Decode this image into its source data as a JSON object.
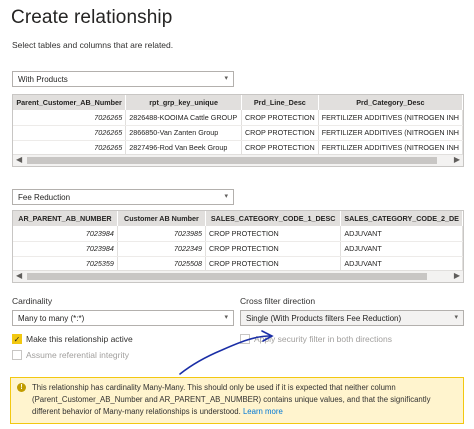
{
  "dialog": {
    "title": "Create relationship",
    "subtitle": "Select tables and columns that are related."
  },
  "table1": {
    "selected": "With Products",
    "columns": [
      "Parent_Customer_AB_Number",
      "rpt_grp_key_unique",
      "Prd_Line_Desc",
      "Prd_Category_Desc"
    ],
    "rows": [
      [
        "7026265",
        "2826488-KOOIMA Cattle GROUP",
        "CROP PROTECTION",
        "FERTILIZER ADDITIVES (NITROGEN INH"
      ],
      [
        "7026265",
        "2866850-Van Zanten Group",
        "CROP PROTECTION",
        "FERTILIZER ADDITIVES (NITROGEN INH"
      ],
      [
        "7026265",
        "2827496-Rod Van Beek Group",
        "CROP PROTECTION",
        "FERTILIZER ADDITIVES (NITROGEN INH"
      ]
    ]
  },
  "table2": {
    "selected": "Fee Reduction",
    "columns": [
      "AR_PARENT_AB_NUMBER",
      "Customer AB Number",
      "SALES_CATEGORY_CODE_1_DESC",
      "SALES_CATEGORY_CODE_2_DE"
    ],
    "rows": [
      [
        "7023984",
        "7023985",
        "CROP PROTECTION",
        "ADJUVANT"
      ],
      [
        "7023984",
        "7022349",
        "CROP PROTECTION",
        "ADJUVANT"
      ],
      [
        "7025359",
        "7025508",
        "CROP PROTECTION",
        "ADJUVANT"
      ]
    ]
  },
  "cardinality": {
    "label": "Cardinality",
    "value": "Many to many (*:*)"
  },
  "cross_filter": {
    "label": "Cross filter direction",
    "value": "Single (With Products filters Fee Reduction)"
  },
  "options": {
    "make_active": "Make this relationship active",
    "assume_integrity": "Assume referential integrity",
    "security_filter": "Apply security filter in both directions"
  },
  "warning": {
    "text": "This relationship has cardinality Many-Many. This should only be used if it is expected that neither column (Parent_Customer_AB_Number and AR_PARENT_AB_NUMBER) contains unique values, and that the significantly different behavior of Many-many relationships is understood.",
    "link": "Learn more"
  },
  "colors": {
    "accent": "#f2c811",
    "warning_bg": "#fff4ce",
    "link": "#0078d4"
  }
}
